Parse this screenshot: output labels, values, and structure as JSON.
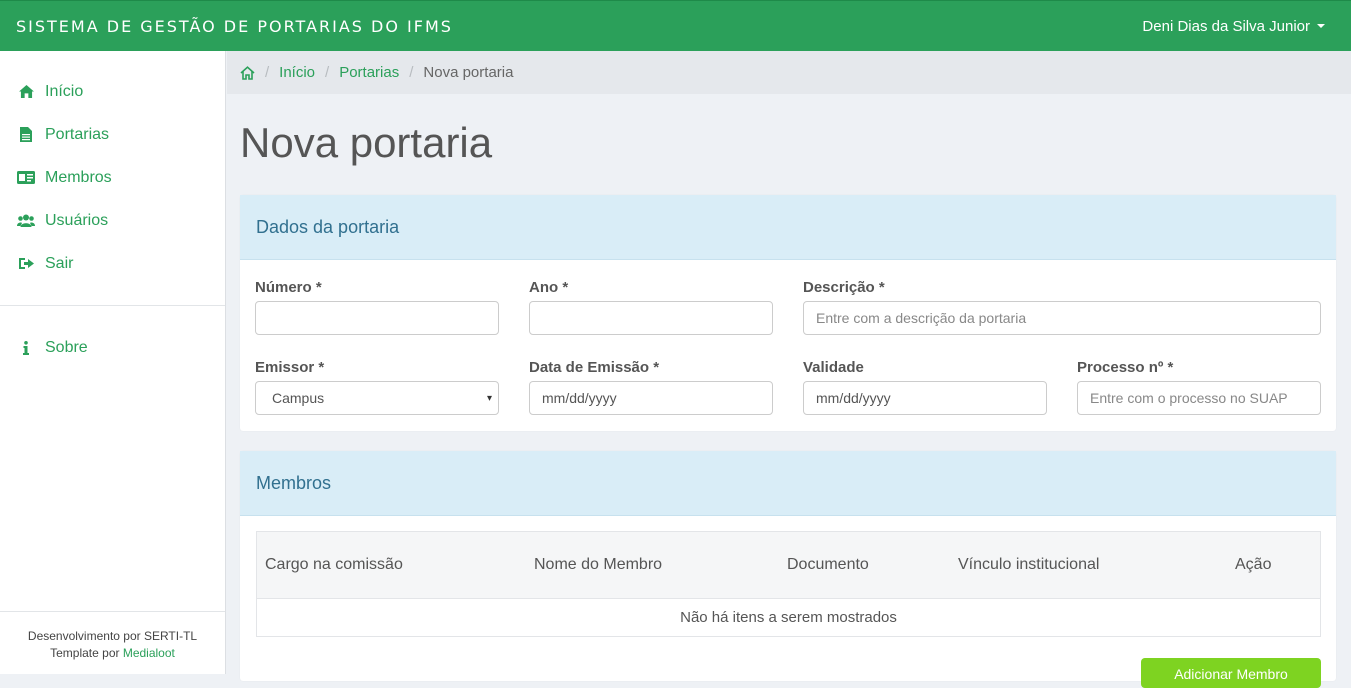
{
  "header": {
    "app_title": "SISTEMA DE GESTÃO DE PORTARIAS DO IFMS",
    "user_name": "Deni Dias da Silva Junior"
  },
  "sidebar": {
    "items": [
      {
        "label": "Início",
        "icon": "home-icon"
      },
      {
        "label": "Portarias",
        "icon": "document-icon"
      },
      {
        "label": "Membros",
        "icon": "id-card-icon"
      },
      {
        "label": "Usuários",
        "icon": "users-icon"
      },
      {
        "label": "Sair",
        "icon": "sign-out-icon"
      }
    ],
    "secondary": {
      "label": "Sobre",
      "icon": "info-icon"
    },
    "footer": {
      "line1": "Desenvolvimento por SERTI-TL",
      "line2_prefix": "Template por ",
      "line2_link": "Medialoot"
    }
  },
  "breadcrumb": {
    "home": "Início",
    "section": "Portarias",
    "current": "Nova portaria"
  },
  "page": {
    "title": "Nova portaria"
  },
  "form": {
    "heading": "Dados da portaria",
    "numero": {
      "label": "Número *",
      "value": ""
    },
    "ano": {
      "label": "Ano *",
      "value": ""
    },
    "descricao": {
      "label": "Descrição *",
      "placeholder": "Entre com a descrição da portaria"
    },
    "emissor": {
      "label": "Emissor *",
      "value": "Campus"
    },
    "data_emissao": {
      "label": "Data de Emissão *",
      "value": "mm/dd/yyyy"
    },
    "validade": {
      "label": "Validade",
      "value": "mm/dd/yyyy"
    },
    "processo": {
      "label": "Processo nº *",
      "placeholder": "Entre com o processo no SUAP"
    }
  },
  "members": {
    "heading": "Membros",
    "columns": [
      "Cargo na comissão",
      "Nome do Membro",
      "Documento",
      "Vínculo institucional",
      "Ação"
    ],
    "empty_text": "Não há itens a serem mostrados",
    "add_button": "Adicionar Membro"
  }
}
